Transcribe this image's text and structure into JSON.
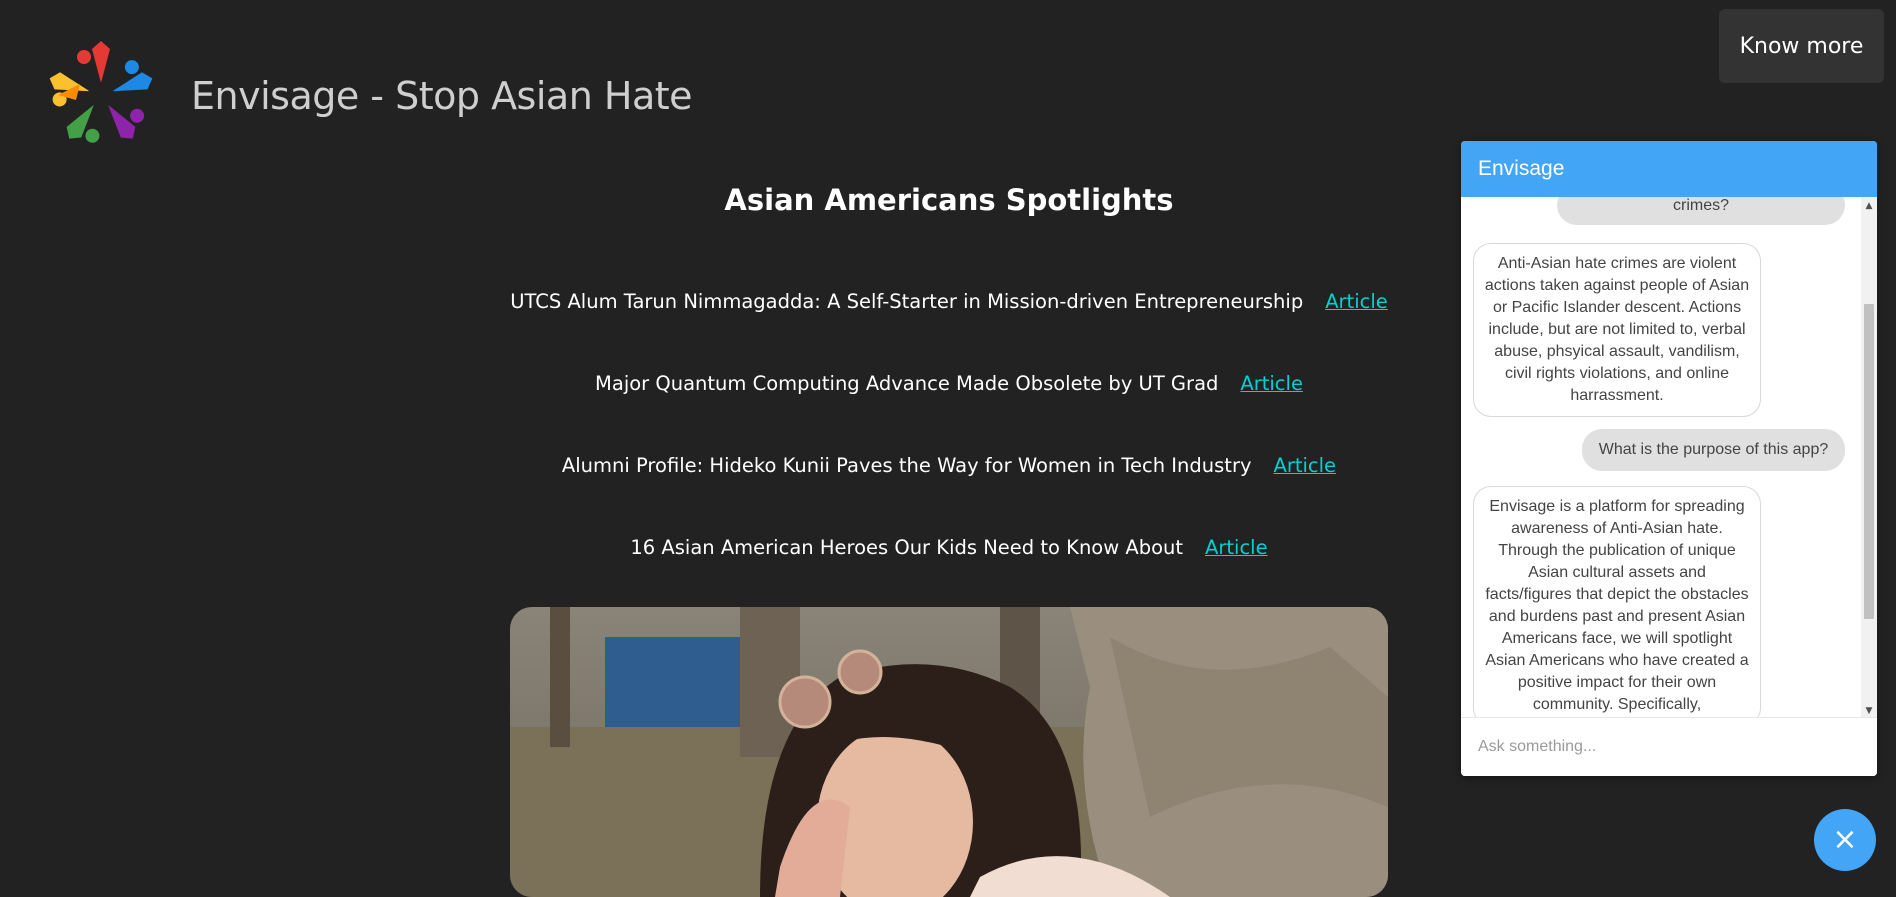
{
  "header": {
    "title": "Envisage - Stop Asian Hate",
    "know_more": "Know more"
  },
  "spotlights": {
    "title": "Asian Americans Spotlights",
    "articles": [
      {
        "headline": "UTCS Alum Tarun Nimmagadda: A Self-Starter in Mission-driven Entrepreneurship",
        "link": "Article"
      },
      {
        "headline": "Major Quantum Computing Advance Made Obsolete by UT Grad",
        "link": "Article"
      },
      {
        "headline": "Alumni Profile: Hideko Kunii Paves the Way for Women in Tech Industry",
        "link": "Article"
      },
      {
        "headline": "16 Asian American Heroes Our Kids Need to Know About",
        "link": "Article"
      }
    ]
  },
  "chat": {
    "title": "Envisage",
    "messages": [
      {
        "from": "user",
        "text": "crimes?"
      },
      {
        "from": "bot",
        "text": "Anti-Asian hate crimes are violent actions taken against people of Asian or Pacific Islander descent. Actions include, but are not limited to, verbal abuse, phsyical assault, vandilism, civil rights violations, and online harrassment."
      },
      {
        "from": "user",
        "text": "What is the purpose of this app?"
      },
      {
        "from": "bot",
        "text": "Envisage is a platform for spreading awareness of Anti-Asian hate. Through the publication of unique Asian cultural assets and facts/figures that depict the obstacles and burdens past and present Asian Americans face, we will spotlight Asian Americans who have created a positive impact for their own community. Specifically,"
      }
    ],
    "input_placeholder": "Ask something...",
    "close_icon": "×"
  },
  "colors": {
    "background": "#222222",
    "accent": "#42a5f5",
    "link": "#00d1d1"
  },
  "icons": [
    "logo-star-people-icon",
    "close-icon",
    "scroll-up-arrow-icon",
    "scroll-down-arrow-icon"
  ]
}
